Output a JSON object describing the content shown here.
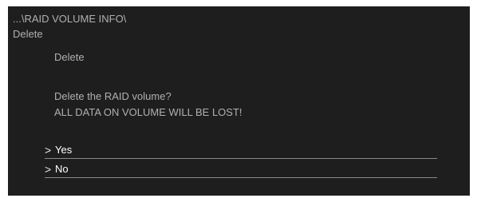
{
  "header": {
    "breadcrumb": "...\\RAID VOLUME INFO\\",
    "section": "Delete"
  },
  "dialog": {
    "subtitle": "Delete",
    "question": "Delete the RAID volume?",
    "warning": "ALL DATA ON VOLUME WILL BE LOST!"
  },
  "options": [
    {
      "label": "Yes",
      "icon": "chevron-right-icon",
      "glyph": ">"
    },
    {
      "label": "No",
      "icon": "chevron-right-icon",
      "glyph": ">"
    }
  ],
  "colors": {
    "panel_background": "#1e1e1e",
    "text": "#b0b0b0",
    "option_text": "#ffffff",
    "underline": "#8a8a8a"
  }
}
